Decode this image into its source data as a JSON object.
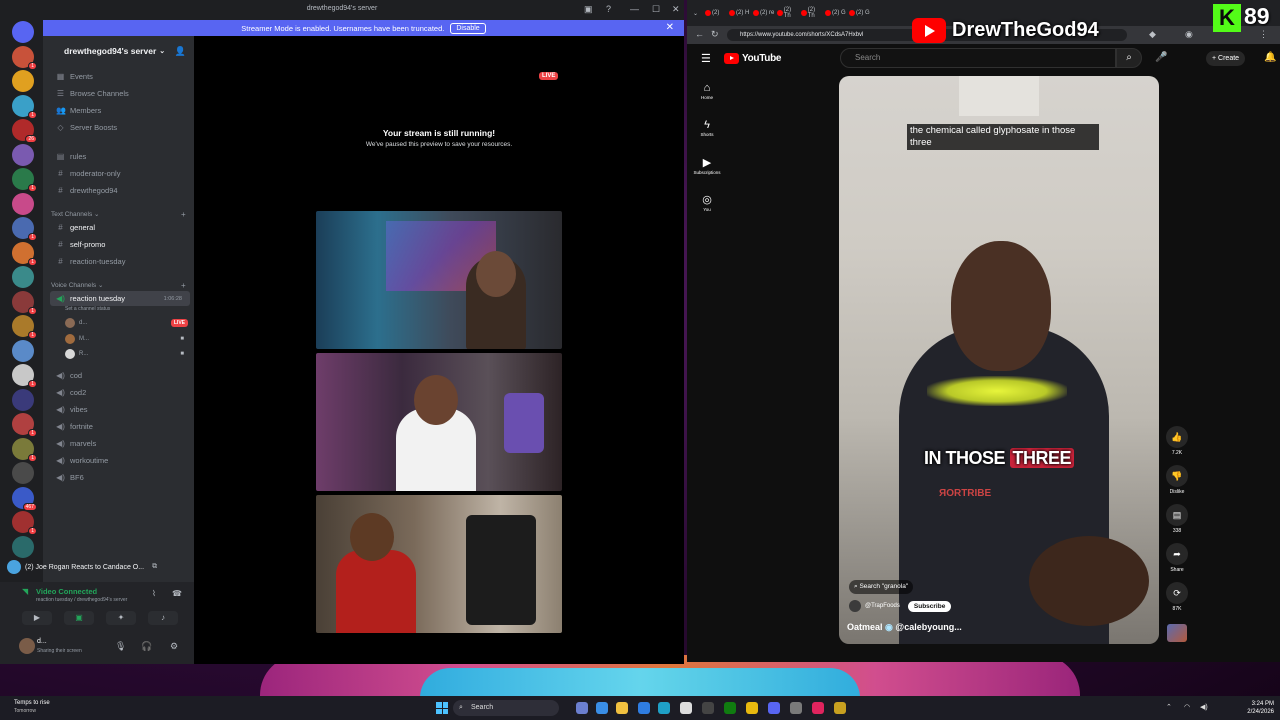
{
  "colors": {
    "discord_bg": "#313338",
    "discord_sidebar": "#2b2d31",
    "discord_rail": "#1e1f22",
    "discord_blurple": "#5865f2",
    "discord_live": "#ed4245",
    "discord_green": "#23a55a",
    "youtube_red": "#ff0000",
    "youtube_bg": "#0f0f0f",
    "kick_green": "#53fc18"
  },
  "discord": {
    "window_title": "drewthegod94's server",
    "banner": {
      "text": "Streamer Mode is enabled. Usernames have been truncated.",
      "button": "Disable"
    },
    "server_name": "drewthegod94's server",
    "menu": [
      "Events",
      "Browse Channels",
      "Members",
      "Server Boosts"
    ],
    "top_channels": [
      "rules",
      "moderator-only",
      "drewthegod94"
    ],
    "text_category": "Text Channels",
    "text_channels": [
      "general",
      "self-promo",
      "reaction-tuesday"
    ],
    "voice_category": "Voice Channels",
    "active_voice": {
      "name": "reaction tuesday",
      "status": "Set a channel status",
      "timer": "1:06:28",
      "users": [
        {
          "name": "d...",
          "live": "LIVE"
        },
        {
          "name": "M..."
        },
        {
          "name": "R..."
        }
      ]
    },
    "voice_channels": [
      "cod",
      "cod2",
      "vibes",
      "fortnite",
      "marvels",
      "workoutime",
      "BF6"
    ],
    "now_playing": "(2) Joe Rogan Reacts to Candace O...",
    "voice_status": {
      "title": "Video Connected",
      "sub": "reaction tuesday / drewthegod94's server"
    },
    "user": {
      "name": "d...",
      "status": "Sharing their screen"
    },
    "stream": {
      "live": "LIVE",
      "headline": "Your stream is still running!",
      "sub": "We've paused this preview to save your resources."
    },
    "servers": [
      {
        "badge": ""
      },
      {
        "badge": "1"
      },
      {
        "badge": ""
      },
      {
        "badge": "1"
      },
      {
        "badge": "26"
      },
      {
        "badge": ""
      },
      {
        "badge": "1"
      },
      {
        "badge": ""
      },
      {
        "badge": "1"
      },
      {
        "badge": "1"
      },
      {
        "badge": ""
      },
      {
        "badge": "1"
      },
      {
        "badge": "1"
      },
      {
        "badge": ""
      },
      {
        "badge": "1"
      },
      {
        "badge": ""
      },
      {
        "badge": "1"
      },
      {
        "badge": "1"
      },
      {
        "badge": ""
      },
      {
        "badge": "467"
      },
      {
        "badge": "1"
      },
      {
        "badge": ""
      }
    ]
  },
  "browser": {
    "url": "https://www.youtube.com/shorts/XCdsA7Hxbvl",
    "tabs": [
      "(2)",
      "(2) H",
      "(2) re",
      "(2) Th",
      "(2) Th",
      "(2) G",
      "(2) G"
    ]
  },
  "youtube": {
    "logo": "YouTube",
    "search_placeholder": "Search",
    "create": "Create",
    "sidebar": [
      "Home",
      "Shorts",
      "Subscriptions",
      "You"
    ],
    "caption_top": "the chemical called glyphosate in those three",
    "caption_big_a": "IN THOSE",
    "caption_big_b": "THREE",
    "search_chip": "Search \"granola\"",
    "channel": "@TrapFoods",
    "subscribe": "Subscribe",
    "title_a": "Oatmeal",
    "title_b": "@calebyoung...",
    "actions": [
      {
        "icon": "like-icon",
        "glyph": "👍",
        "label": "7.2K"
      },
      {
        "icon": "dislike-icon",
        "glyph": "👎",
        "label": "Dislike"
      },
      {
        "icon": "comment-icon",
        "glyph": "▤",
        "label": "338"
      },
      {
        "icon": "share-icon",
        "glyph": "➦",
        "label": "Share"
      },
      {
        "icon": "remix-icon",
        "glyph": "⟳",
        "label": "87K"
      }
    ]
  },
  "overlay": {
    "brand_name": "DrewTheGod94",
    "kick_logo": "K",
    "kick_count": "89"
  },
  "taskbar": {
    "weather_title": "Temps to rise",
    "weather_sub": "Tomorrow",
    "search": "Search",
    "time": "3:24 PM",
    "date": "2/24/2026"
  }
}
